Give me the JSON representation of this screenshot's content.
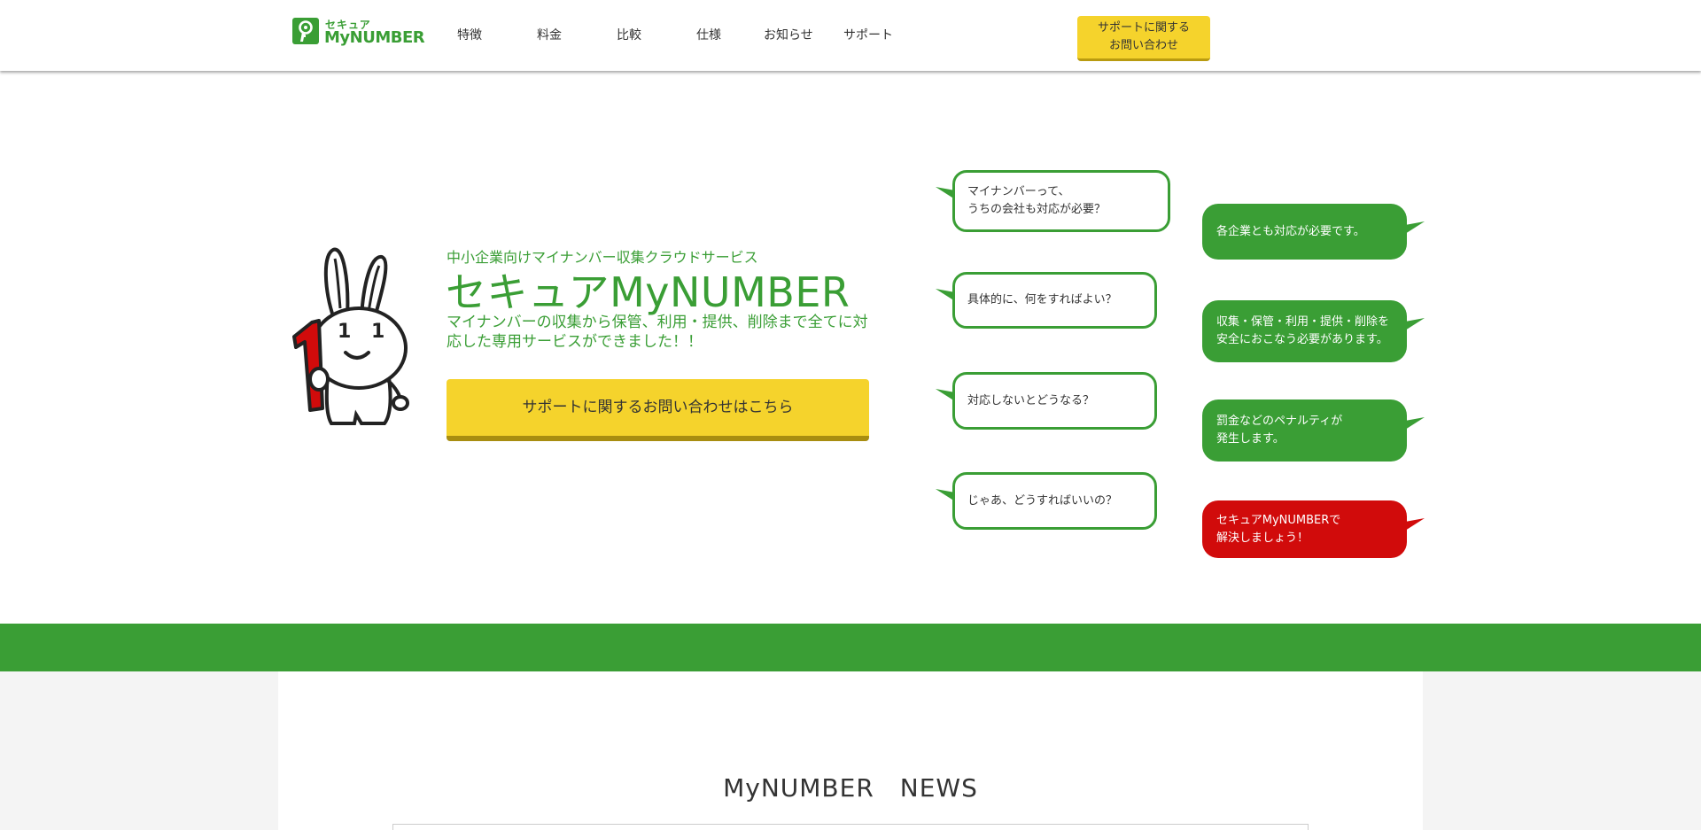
{
  "header": {
    "logo_small": "セキュア",
    "logo_big": "MyNUMBER",
    "nav": [
      "特徴",
      "料金",
      "比較",
      "仕様",
      "お知らせ",
      "サポート"
    ],
    "cta_line1": "サポートに関する",
    "cta_line2": "お問い合わせ"
  },
  "hero": {
    "subtitle": "中小企業向けマイナンバー収集クラウドサービス",
    "title": "セキュアMyNUMBER",
    "description": "マイナンバーの収集から保管、利用・提供、削除まで全てに対応した専用サービスができました！！",
    "cta": "サポートに関するお問い合わせはこちら",
    "mascot_numbers": [
      "1",
      "1",
      "1"
    ]
  },
  "questions": [
    {
      "line1": "マイナンバーって、",
      "line2": "うちの会社も対応が必要？"
    },
    {
      "line1": "具体的に、何をすればよい？",
      "line2": ""
    },
    {
      "line1": "対応しないとどうなる？",
      "line2": ""
    },
    {
      "line1": "じゃあ、どうすればいいの？",
      "line2": ""
    }
  ],
  "answers": [
    {
      "line1": "各企業とも対応が必要です。",
      "line2": ""
    },
    {
      "line1": "収集・保管・利用・提供・削除を",
      "line2": "安全におこなう必要があります。"
    },
    {
      "line1": "罰金などのペナルティが",
      "line2": "発生します。"
    },
    {
      "line1": "セキュアMyNUMBERで",
      "line2": "解決しましょう！"
    }
  ],
  "colors": {
    "brand_green": "#3a9e35",
    "cta_yellow": "#f5d32c",
    "alert_red": "#d10b0b"
  },
  "news": {
    "title": "MyNUMBER　NEWS"
  }
}
